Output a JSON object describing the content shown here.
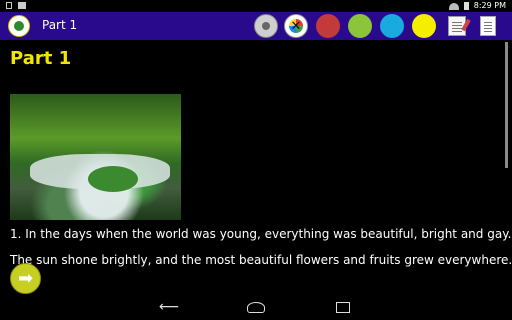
{
  "status": {
    "time": "8:29 PM",
    "icons": [
      "image-notification-icon",
      "download-notification-icon",
      "wifi-icon",
      "battery-icon"
    ]
  },
  "appbar": {
    "title": "Part 1",
    "bg": "#2a0a8c",
    "tools": [
      "speaker-icon",
      "color-palette-icon",
      "red-color",
      "green-color",
      "blue-color",
      "yellow-color",
      "notes-icon",
      "document-icon"
    ],
    "colors": {
      "red": "#c33a3a",
      "green": "#8cc43a",
      "blue": "#19aadf",
      "yellow": "#f5ee00"
    }
  },
  "content": {
    "heading": "Part 1",
    "heading_color": "#f2e600",
    "image": "forest-stream-photo",
    "paragraphs": [
      "1. In the days when the world was young, everything was beautiful, bright and gay.",
      "The sun shone brightly, and the most beautiful flowers and fruits grew everywhere."
    ]
  },
  "navbar": {
    "back_glyph": "⟵",
    "icons": [
      "back-icon",
      "home-icon",
      "recents-icon"
    ]
  },
  "next_button": {
    "glyph": "➡",
    "color": "#c7cf22"
  }
}
